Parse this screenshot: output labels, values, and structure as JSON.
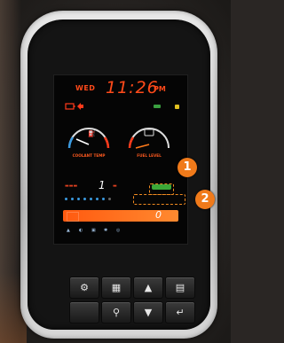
{
  "clock": {
    "day": "WED",
    "time": "11:26",
    "ampm": "PM"
  },
  "gauges": {
    "left_label": "COOLANT TEMP",
    "right_label": "FUEL LEVEL",
    "left_icon": "oil-temp-icon",
    "right_icon": "fuel-pump-icon"
  },
  "temp_row": {
    "value": "1"
  },
  "bar": {
    "value": "0"
  },
  "callouts": [
    "1",
    "2"
  ],
  "colors": {
    "accent": "#ff4a1a",
    "bezel": "#d0d0d0",
    "callout": "#f07a1a",
    "indicator": "#3ca838"
  },
  "buttons": [
    {
      "icon": "engine-mode-icon",
      "glyph": "⚙"
    },
    {
      "icon": "fuel-can-icon",
      "glyph": "▦"
    },
    {
      "icon": "up-arrow-icon",
      "glyph": "▲"
    },
    {
      "icon": "menu-list-icon",
      "glyph": "▤"
    },
    {
      "icon": "blank-icon",
      "glyph": ""
    },
    {
      "icon": "location-icon",
      "glyph": "⚲"
    },
    {
      "icon": "down-arrow-icon",
      "glyph": "▼"
    },
    {
      "icon": "enter-icon",
      "glyph": "↵"
    }
  ]
}
